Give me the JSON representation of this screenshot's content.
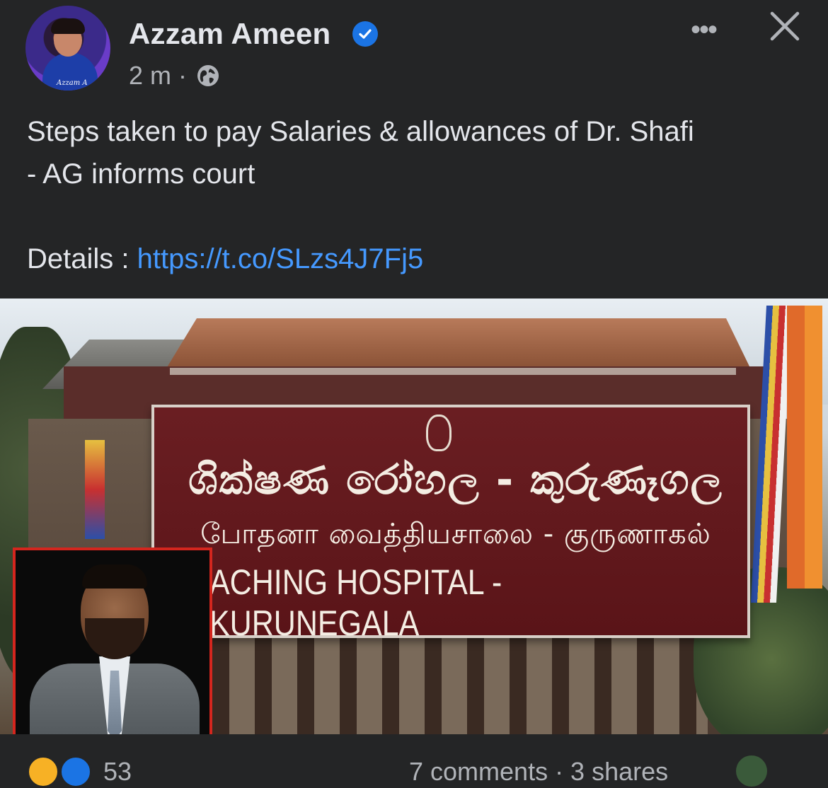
{
  "post": {
    "author": "Azzam Ameen",
    "time": "2 m",
    "separator": "·",
    "privacy_icon": "globe-icon",
    "verified_icon": "verified-badge-icon",
    "text": "Steps taken to pay Salaries & allowances of Dr. Shafi\n- AG informs court",
    "details_label": "Details : ",
    "link": "https://t.co/SLzs4J7Fj5",
    "avatar_signature": "Azzam A"
  },
  "actions": {
    "more_label": "•••",
    "close_icon": "close-icon"
  },
  "image": {
    "sign_sinhala": "ශික්ෂණ රෝහල - කුරුණෑගල",
    "sign_tamil": "போதனா வைத்தியசாலை - குருணாகல்",
    "sign_english": "ACHING HOSPITAL - KURUNEGALA"
  },
  "reactions": {
    "count": "53",
    "comments": "7 comments · 3 shares"
  },
  "colors": {
    "background": "#242526",
    "text": "#e4e6eb",
    "secondary_text": "#b0b3b8",
    "link": "#4599ff",
    "verified": "#1b74e4"
  }
}
